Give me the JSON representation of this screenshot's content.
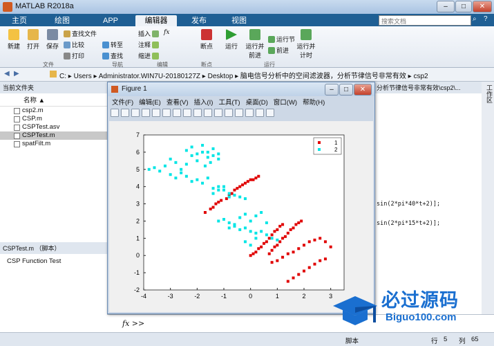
{
  "app": {
    "title": "MATLAB R2018a"
  },
  "tabs": [
    "主页",
    "绘图",
    "APP",
    "编辑器",
    "发布",
    "视图"
  ],
  "active_tab": 3,
  "search": {
    "placeholder": "搜索文档"
  },
  "ribbon": {
    "new": "新建",
    "open": "打开",
    "save": "保存",
    "find_files": "查找文件",
    "compare": "比较",
    "print": "打印",
    "go_to": "转至",
    "find": "查找",
    "insert": "插入",
    "fx": "fx",
    "comment": "注释",
    "indent": "缩进",
    "breakpoints": "断点",
    "run": "运行",
    "run_advance": "运行并\n前进",
    "run_section": "运行节",
    "advance": "前进",
    "run_time": "运行并\n计时",
    "groups": {
      "file": "文件",
      "nav": "导航",
      "edit": "编辑",
      "bp": "断点",
      "run": "运行"
    }
  },
  "address": [
    "C:",
    "Users",
    "Administrator.WIN7U-20180127Z",
    "Desktop",
    "脑电信号分析中的空间滤波器，分析节律信号非常有效",
    "csp2"
  ],
  "editor_path": "分析节律信号非常有效\\csp2\\...",
  "files_panel": {
    "title": "当前文件夹",
    "col_name": "名称 ▲",
    "files": [
      "csp2.m",
      "CSP.m",
      "CSPTest.asv",
      "CSPTest.m",
      "spatFilt.m"
    ],
    "selected": 3
  },
  "details": {
    "title": "CSPTest.m （脚本）",
    "text": "CSP Function Test"
  },
  "figure": {
    "title": "Figure 1",
    "menu": [
      "文件(F)",
      "编辑(E)",
      "查看(V)",
      "插入(I)",
      "工具(T)",
      "桌面(D)",
      "窗口(W)",
      "帮助(H)"
    ]
  },
  "editor_code": [
    "sin(2*pi*40*t+2)];",
    "sin(2*pi*15*t+2)];"
  ],
  "command": {
    "prompt": "fx >>"
  },
  "status": {
    "script": "脚本",
    "row_label": "行",
    "row": "5",
    "col_label": "列",
    "col": "65"
  },
  "side_tab": "工作区",
  "watermark": {
    "text1": "必过源码",
    "text2": "Biguo100.com"
  },
  "chart_data": {
    "type": "scatter",
    "xlim": [
      -4,
      3.5
    ],
    "ylim": [
      -2,
      7
    ],
    "xticks": [
      -4,
      -3,
      -2,
      -1,
      0,
      1,
      2,
      3
    ],
    "yticks": [
      -2,
      -1,
      0,
      1,
      2,
      3,
      4,
      5,
      6,
      7
    ],
    "legend_position": "top-right",
    "series": [
      {
        "name": "1",
        "color": "#e00000",
        "x": [
          -1.7,
          -1.5,
          -1.4,
          -1.3,
          -1.2,
          -1.1,
          -0.9,
          -0.8,
          -0.7,
          -0.6,
          -0.5,
          -0.4,
          -0.3,
          -0.2,
          -0.1,
          0.0,
          0.1,
          0.2,
          0.3,
          0.0,
          0.1,
          0.2,
          0.3,
          0.4,
          0.5,
          0.6,
          0.7,
          0.8,
          0.9,
          1.0,
          1.1,
          1.2,
          0.7,
          0.8,
          0.9,
          1.0,
          1.1,
          1.2,
          1.3,
          1.4,
          1.5,
          1.6,
          1.7,
          1.8,
          1.9,
          0.8,
          1.0,
          1.2,
          1.4,
          1.6,
          1.8,
          2.0,
          2.2,
          2.4,
          2.6,
          2.8,
          3.0,
          1.4,
          1.6,
          1.8,
          2.0,
          2.2,
          2.4,
          2.6,
          2.8
        ],
        "y": [
          2.5,
          2.7,
          2.8,
          3.0,
          3.1,
          3.2,
          3.3,
          3.5,
          3.6,
          3.8,
          3.9,
          4.0,
          4.1,
          4.2,
          4.3,
          4.4,
          4.4,
          4.5,
          4.6,
          0.0,
          0.1,
          0.2,
          0.4,
          0.5,
          0.7,
          0.8,
          1.0,
          1.2,
          1.4,
          1.5,
          1.7,
          1.8,
          0.1,
          0.3,
          0.5,
          0.6,
          0.8,
          1.0,
          1.1,
          1.3,
          1.5,
          1.6,
          1.8,
          1.9,
          2.0,
          -0.4,
          -0.3,
          -0.1,
          0.1,
          0.2,
          0.4,
          0.6,
          0.8,
          0.9,
          1.0,
          0.8,
          0.5,
          -1.5,
          -1.3,
          -1.1,
          -0.9,
          -0.7,
          -0.5,
          -0.3,
          -0.2
        ]
      },
      {
        "name": "2",
        "color": "#00e5e5",
        "x": [
          -3.8,
          -3.6,
          -3.4,
          -3.2,
          -3.0,
          -2.8,
          -2.6,
          -2.4,
          -2.2,
          -2.0,
          -1.8,
          -1.6,
          -1.4,
          -1.2,
          -1.0,
          -0.8,
          -0.6,
          -0.4,
          -0.2,
          -3.0,
          -2.8,
          -2.6,
          -2.4,
          -2.2,
          -2.0,
          -1.8,
          -1.6,
          -1.4,
          -1.2,
          -2.4,
          -2.2,
          -2.0,
          -1.8,
          -1.6,
          -1.4,
          -1.2,
          -1.7,
          -1.5,
          -1.2,
          -1.0,
          -0.8,
          -0.6,
          -0.4,
          -0.2,
          0.0,
          0.2,
          0.4,
          0.6,
          0.8,
          1.0,
          -0.8,
          -0.6,
          -0.4,
          -0.2,
          0.0,
          0.2,
          0.4,
          0.6,
          -0.2,
          0.0,
          0.2,
          -1.4,
          -1.2,
          -1.0,
          -0.8
        ],
        "y": [
          5.0,
          5.1,
          4.9,
          5.2,
          4.7,
          4.5,
          4.8,
          4.6,
          4.3,
          4.4,
          4.2,
          4.5,
          3.9,
          4.0,
          3.8,
          3.6,
          3.5,
          3.4,
          3.3,
          5.6,
          5.4,
          5.0,
          5.3,
          5.8,
          5.5,
          6.0,
          5.7,
          6.2,
          5.9,
          6.1,
          6.3,
          5.9,
          6.4,
          6.0,
          5.8,
          5.6,
          5.2,
          5.4,
          2.0,
          2.1,
          1.9,
          1.7,
          1.5,
          1.6,
          1.4,
          1.3,
          1.4,
          1.2,
          1.0,
          0.9,
          1.6,
          1.8,
          2.2,
          2.4,
          2.0,
          2.3,
          2.5,
          1.9,
          0.8,
          0.6,
          1.0,
          3.6,
          3.8,
          4.0,
          3.4
        ]
      }
    ]
  }
}
